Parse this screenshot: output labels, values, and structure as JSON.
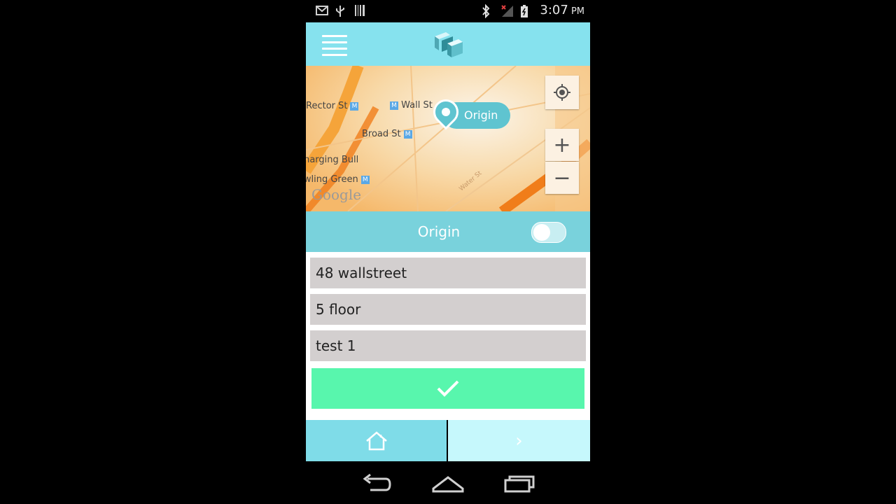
{
  "status_bar": {
    "time": "3:07",
    "ampm": "PM",
    "icons": [
      "gmail-icon",
      "usb-icon",
      "barcode-icon",
      "bluetooth-icon",
      "no-signal-icon",
      "battery-charging-icon"
    ]
  },
  "header": {
    "menu_icon": "hamburger-icon",
    "logo_icon": "cube-logo-icon"
  },
  "map": {
    "labels": {
      "rector": "Rector St",
      "wall": "Wall St",
      "broad": "Broad St",
      "bull": "Charging Bull",
      "green": "Bowling Green",
      "road": "Water St"
    },
    "metro_symbol": "M",
    "attribution": "Google",
    "pin_label": "Origin",
    "zoom_in": "+",
    "zoom_out": "−"
  },
  "origin": {
    "title": "Origin",
    "toggle_on": false
  },
  "form": {
    "address": "48 wallstreet",
    "floor": "5 floor",
    "note": "test 1",
    "submit_icon": "checkmark-icon"
  },
  "bottom_nav": {
    "home_icon": "home-icon",
    "next_label": "›"
  },
  "colors": {
    "header": "#86e2ee",
    "origin_bar": "#79d2dc",
    "submit": "#58f6ad",
    "field_bg": "#d3cfcf",
    "nav_home": "#7fdce8",
    "nav_next": "#c6f8fc"
  }
}
